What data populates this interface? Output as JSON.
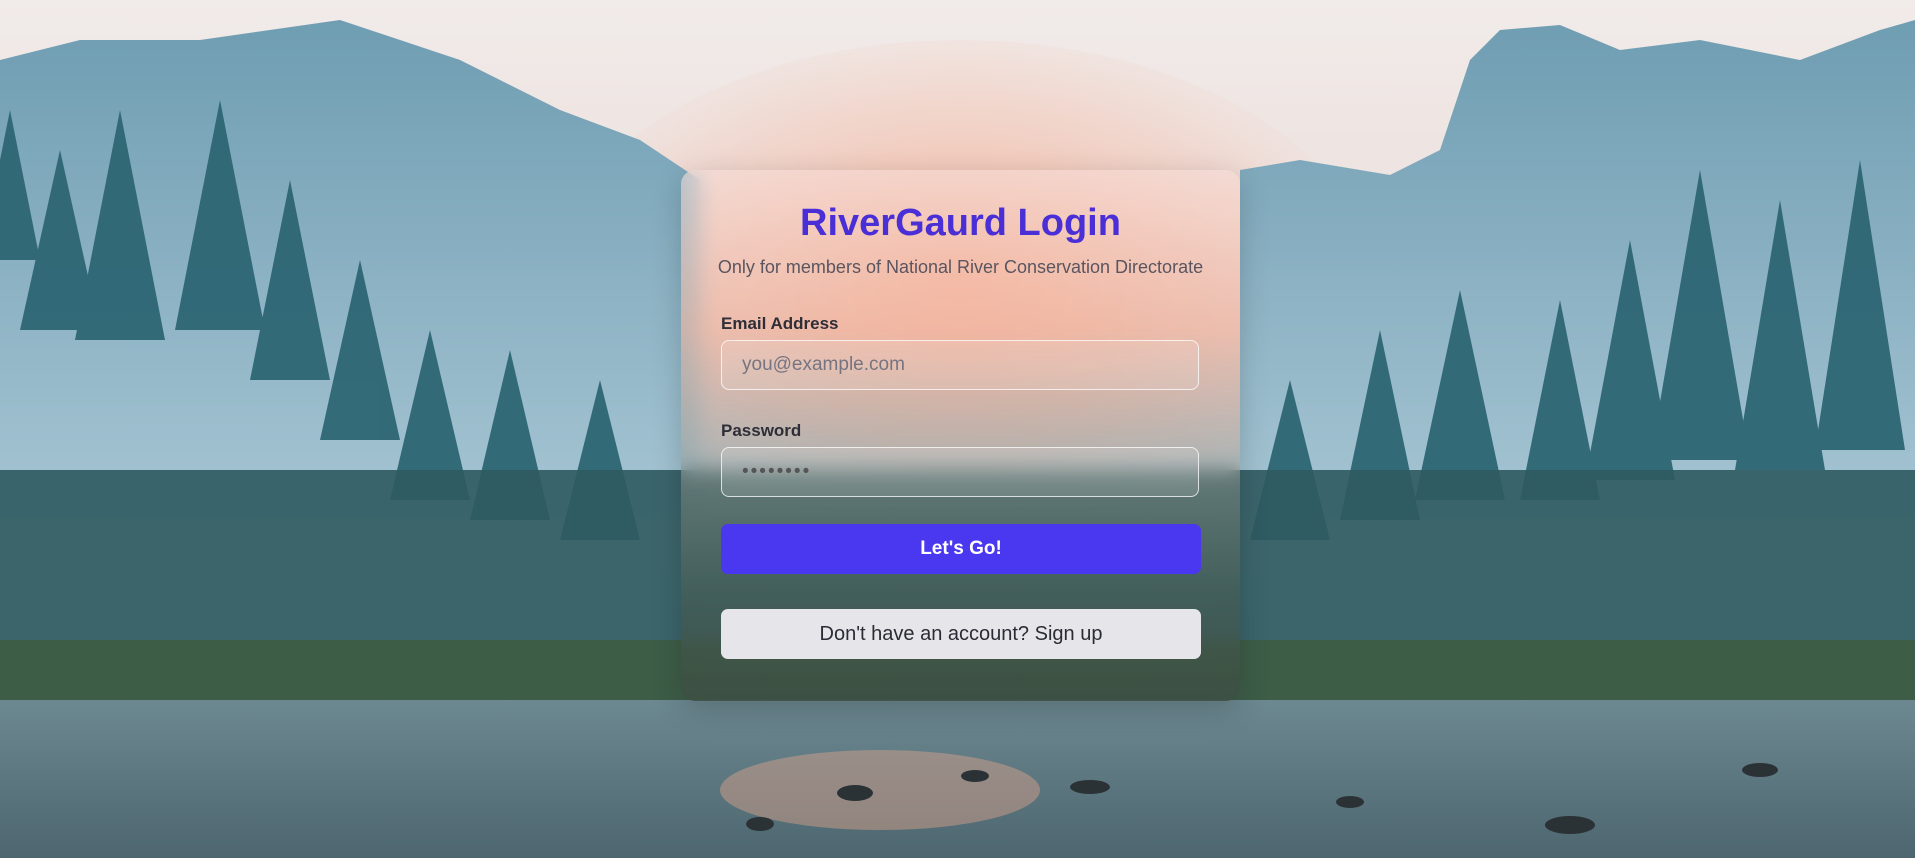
{
  "login": {
    "title": "RiverGaurd Login",
    "subtitle": "Only for members of National River Conservation Directorate",
    "email_label": "Email Address",
    "email_placeholder": "you@example.com",
    "password_label": "Password",
    "password_value": "••••••••",
    "submit_label": "Let's Go!",
    "signup_label": "Don't have an account? Sign up"
  },
  "colors": {
    "title": "#4a2fd6",
    "primary_button": "#4a37f0",
    "secondary_button": "#e6e6ea"
  }
}
